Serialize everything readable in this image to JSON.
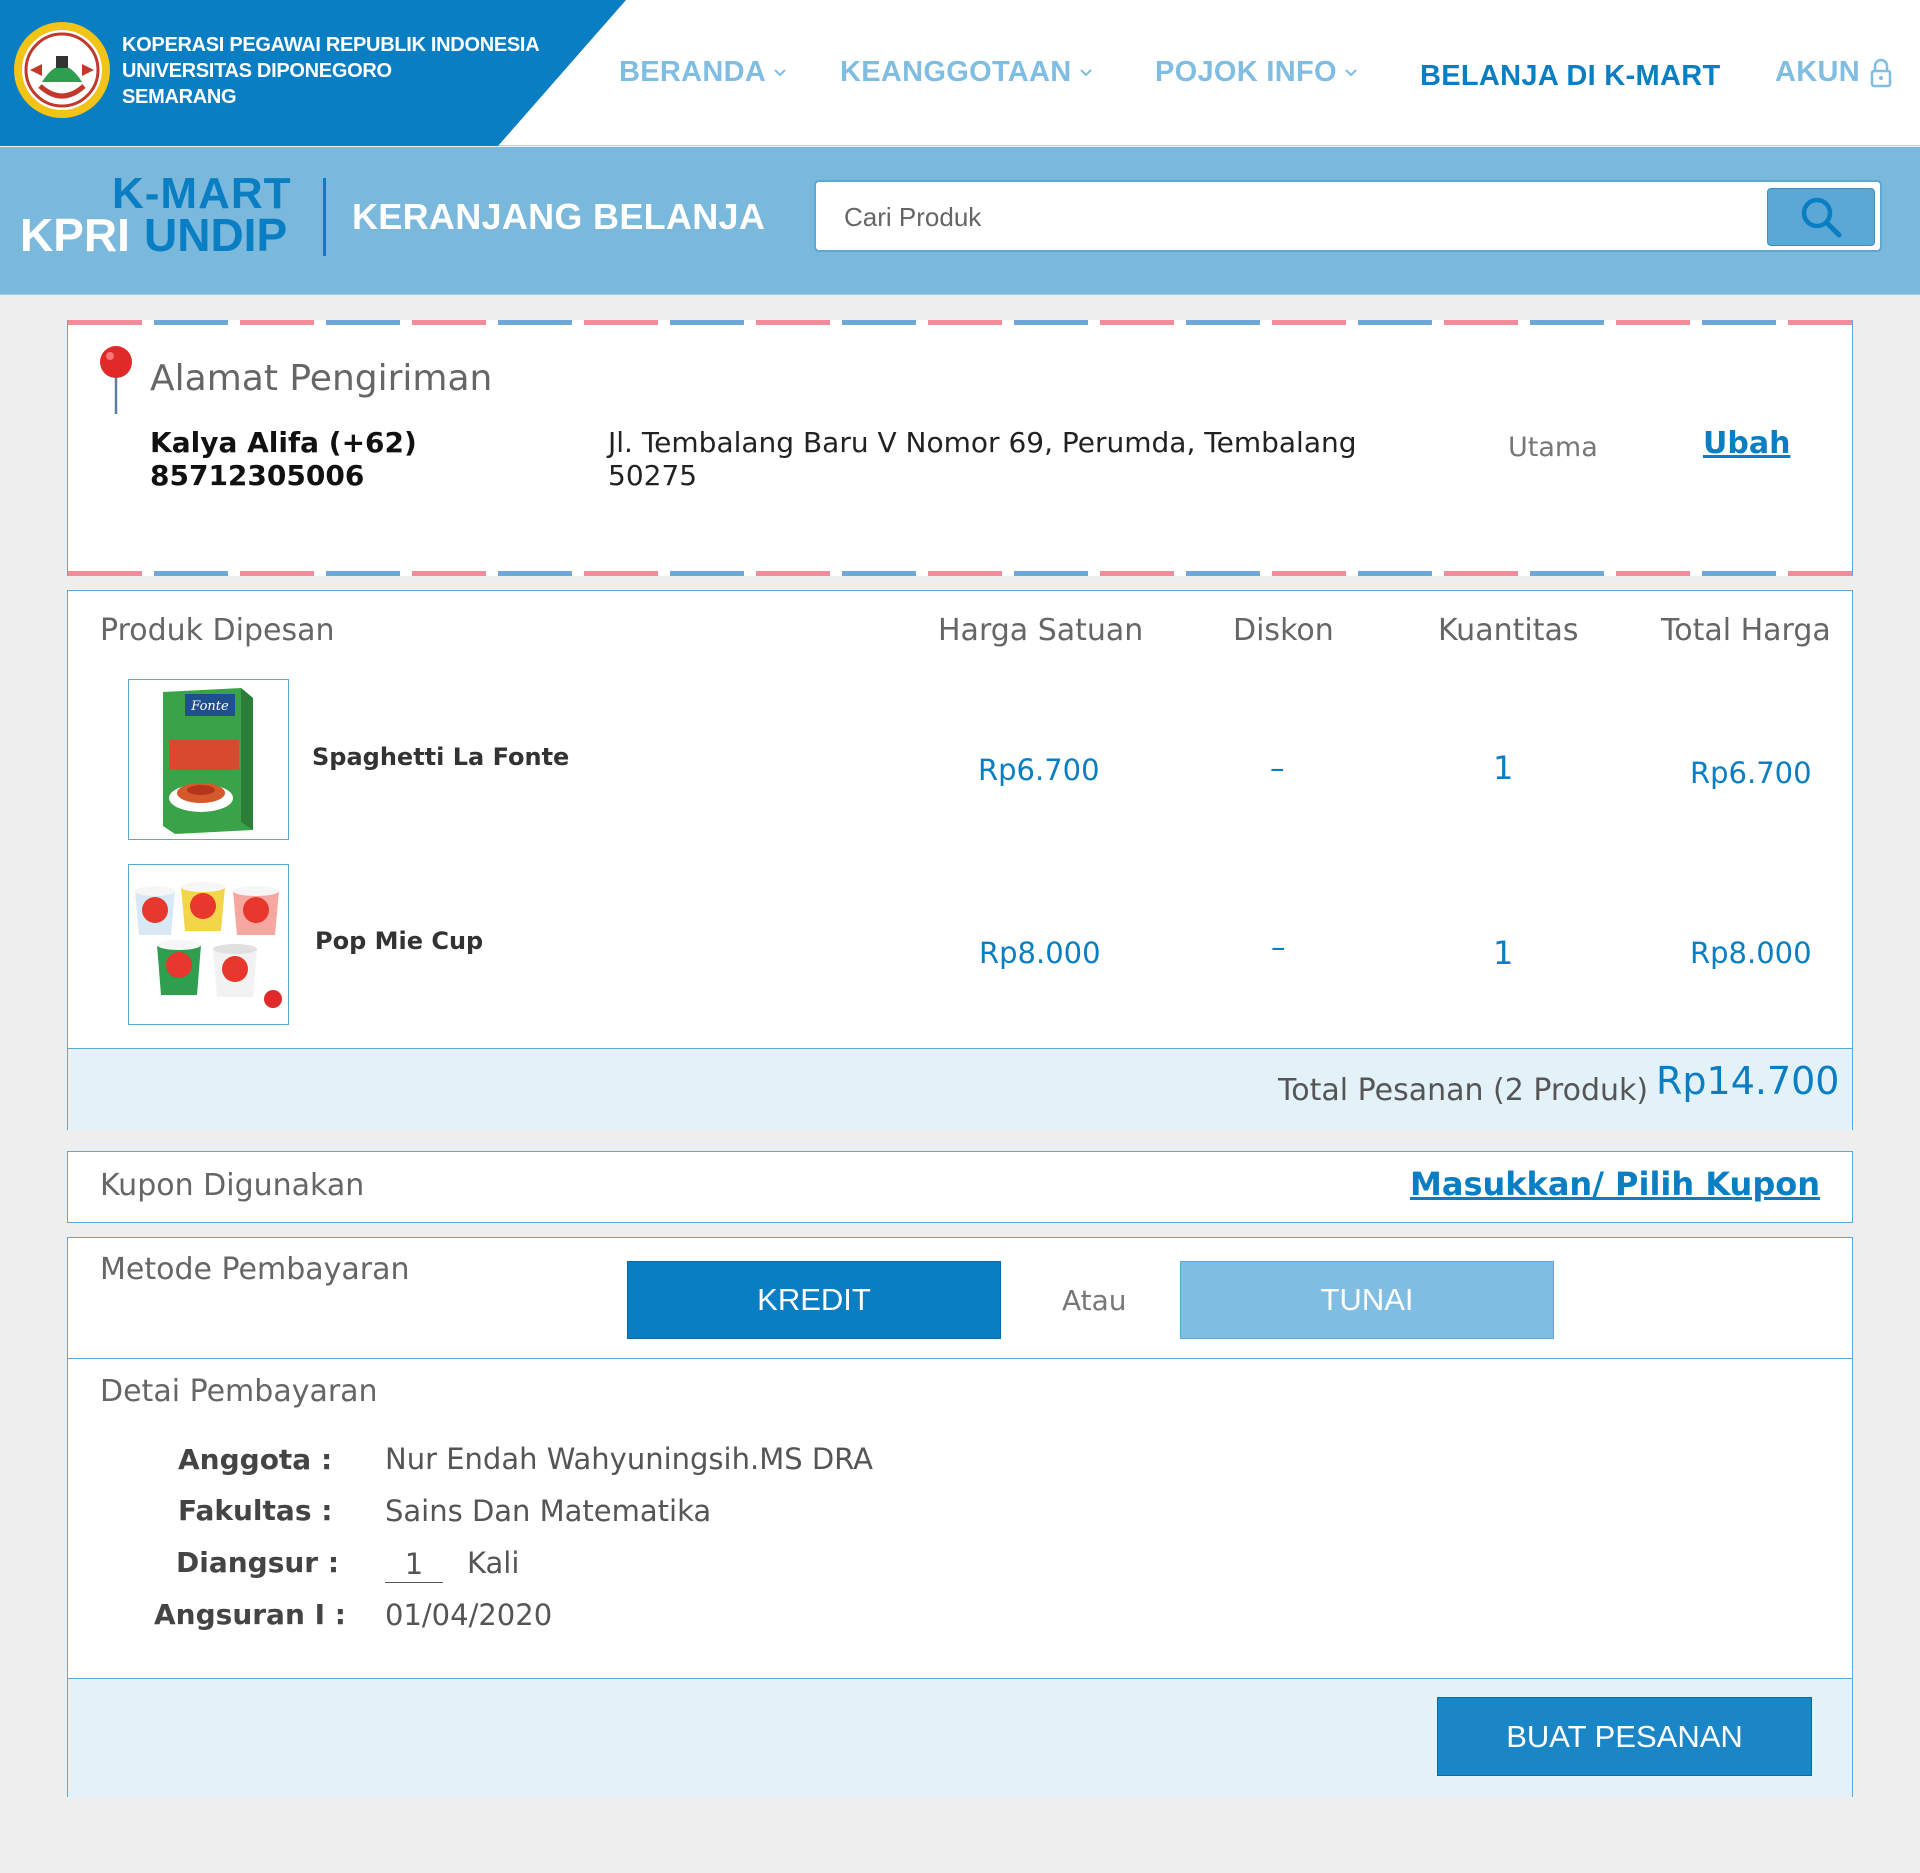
{
  "header": {
    "org_line1": "KOPERASI PEGAWAI REPUBLIK INDONESIA",
    "org_line2": "UNIVERSITAS DIPONEGORO",
    "org_line3": "SEMARANG",
    "nav": [
      {
        "label": "BERANDA",
        "has_dropdown": true
      },
      {
        "label": "KEANGGOTAAN",
        "has_dropdown": true
      },
      {
        "label": "POJOK INFO",
        "has_dropdown": true
      },
      {
        "label": "BELANJA DI K-MART",
        "active": true
      },
      {
        "label": "AKUN",
        "icon": "lock-icon"
      }
    ]
  },
  "subheader": {
    "brand_top": "K-MART",
    "brand_kpri": "KPRI",
    "brand_undip": "UNDIP",
    "page_title": "KERANJANG BELANJA",
    "search_placeholder": "Cari Produk",
    "search_icon": "search-icon"
  },
  "address": {
    "title": "Alamat Pengiriman",
    "name_phone": "Kalya Alifa (+62) 85712305006",
    "address": "Jl. Tembalang Baru V Nomor 69, Perumda, Tembalang 50275",
    "tag": "Utama",
    "edit_label": "Ubah"
  },
  "products": {
    "headers": {
      "product": "Produk Dipesan",
      "unit_price": "Harga Satuan",
      "discount": "Diskon",
      "quantity": "Kuantitas",
      "total": "Total Harga"
    },
    "items": [
      {
        "name": "Spaghetti La Fonte",
        "unit_price": "Rp6.700",
        "discount": "–",
        "quantity": "1",
        "total": "Rp6.700"
      },
      {
        "name": "Pop Mie Cup",
        "unit_price": "Rp8.000",
        "discount": "–",
        "quantity": "1",
        "total": "Rp8.000"
      }
    ],
    "order_total_label": "Total Pesanan (2 Produk)",
    "order_total_value": "Rp14.700"
  },
  "coupon": {
    "label": "Kupon Digunakan",
    "link": "Masukkan/ Pilih Kupon"
  },
  "payment": {
    "method_label": "Metode Pembayaran",
    "kredit_label": "KREDIT",
    "or_label": "Atau",
    "tunai_label": "TUNAI",
    "selected": "KREDIT",
    "detail_title": "Detai Pembayaran",
    "member_label": "Anggota :",
    "member_value": "Nur Endah Wahyuningsih.MS DRA",
    "faculty_label": "Fakultas  :",
    "faculty_value": "Sains Dan Matematika",
    "installment_label": "Diangsur :",
    "installment_value": "1",
    "installment_unit": "Kali",
    "first_installment_label": "Angsuran I :",
    "first_installment_value": "01/04/2020",
    "order_button": "BUAT PESANAN"
  },
  "colors": {
    "primary": "#0a7ec2",
    "light_blue": "#7ab8dc",
    "button_light": "#7fbde3",
    "band": "#e3f1f9",
    "background": "#eeeeee"
  }
}
